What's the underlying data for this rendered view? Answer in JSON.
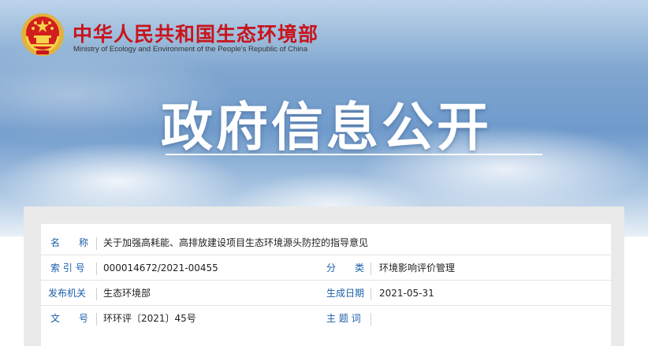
{
  "header": {
    "org_name_cn": "中华人民共和国生态环境部",
    "org_name_en": "Ministry of Ecology and Environment of the People's Republic of China",
    "emblem_icon": "national-emblem-icon"
  },
  "hero": {
    "title": "政府信息公开"
  },
  "info": {
    "name_label": "名　　称",
    "name_value": "关于加强高耗能、高排放建设项目生态环境源头防控的指导意见",
    "index_label": "索 引 号",
    "index_value": "000014672/2021-00455",
    "category_label": "分　　类",
    "category_value": "环境影响评价管理",
    "publisher_label": "发布机关",
    "publisher_value": "生态环境部",
    "date_label": "生成日期",
    "date_value": "2021-05-31",
    "docno_label": "文　　号",
    "docno_value": "环环评〔2021〕45号",
    "subject_label": "主 题 词",
    "subject_value": ""
  },
  "colors": {
    "brand_red": "#c8141b",
    "label_blue": "#1a5fa8"
  }
}
